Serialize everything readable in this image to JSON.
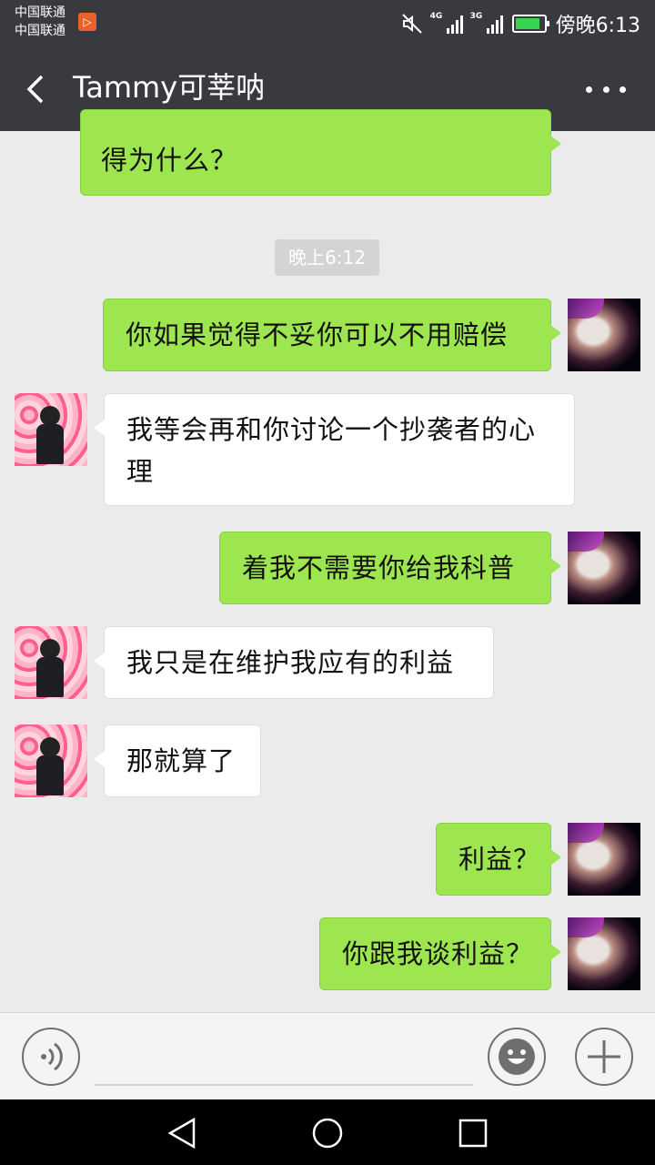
{
  "status_bar": {
    "carrier1": "中国联通",
    "carrier2": "中国联通",
    "network1": "4G",
    "network2": "3G",
    "time": "傍晚6:13"
  },
  "header": {
    "title": "Tammy可莘呐"
  },
  "timestamp": "晚上6:12",
  "messages": [
    {
      "sender": "me",
      "text": "得为什么？"
    },
    {
      "sender": "me",
      "text": "你如果觉得不妥你可以不用赔偿"
    },
    {
      "sender": "them",
      "line1": "我等会再和你讨论一个抄袭者的心",
      "line2": "理"
    },
    {
      "sender": "me",
      "text": "着我不需要你给我科普"
    },
    {
      "sender": "them",
      "text": "我只是在维护我应有的利益"
    },
    {
      "sender": "them",
      "text": "那就算了"
    },
    {
      "sender": "me",
      "text": "利益？"
    },
    {
      "sender": "me",
      "text": "你跟我谈利益？"
    }
  ],
  "icons": {
    "back": "chevron-left-icon",
    "more": "more-icon",
    "voice": "voice-icon",
    "emoji": "emoji-icon",
    "plus": "plus-icon"
  },
  "colors": {
    "outgoing_bubble": "#9ee64f",
    "incoming_bubble": "#ffffff",
    "header_bg": "#393a3f",
    "chat_bg": "#ebebeb"
  }
}
